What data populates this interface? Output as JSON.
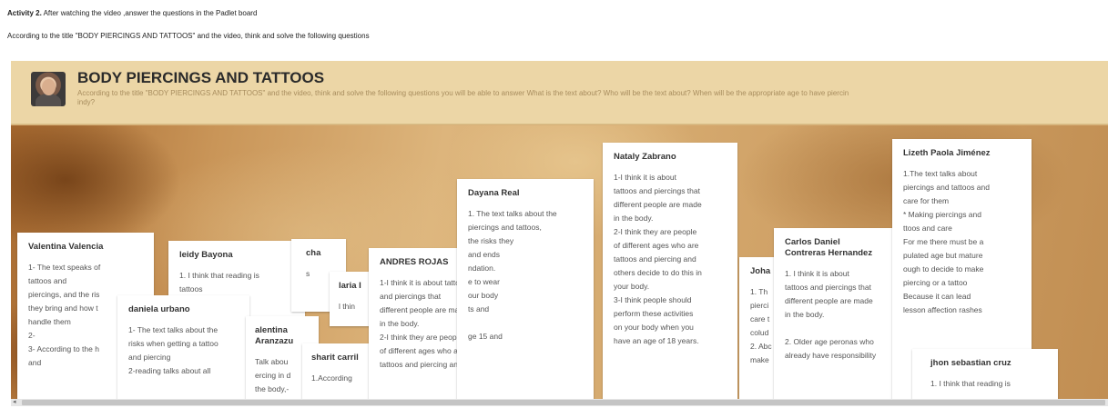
{
  "instructions": {
    "activity_label": "Activity 2.",
    "activity_text": " After watching the video ,answer the questions in the Padlet board",
    "subtitle": "According to the title  \"BODY PIERCINGS AND TATTOOS\" and the video, think and solve the following questions"
  },
  "board": {
    "title": "BODY PIERCINGS AND TATTOOS",
    "description": "According to the title \"BODY PIERCINGS AND TATTOOS\" and the video, think and solve the following questions  you will be able to answer What is the text about? Who will be the text about? When will be the appropriate age to have piercin",
    "description_line2": "indy?"
  },
  "posts": [
    {
      "author": "Valentina Valencia",
      "body": "1- The text speaks of\ntattoos and\npiercings, and the ris\nthey bring and how t\nhandle them\n2-\n3- According to the h\nand"
    },
    {
      "author": "leidy Bayona",
      "body": "1.  I think that reading is\n                    tattoos"
    },
    {
      "author": "cha",
      "body": "s"
    },
    {
      "author": "daniela urbano",
      "body": "1- The text talks about the\nrisks when getting a tattoo\nand piercing\n2-reading talks about all"
    },
    {
      "author": "alentina Aranzazu",
      "body": "Talk abou\nercing in d\nthe body,-"
    },
    {
      "author": "laria I",
      "body": "l thin"
    },
    {
      "author": "sharit carril",
      "body": "1.According"
    },
    {
      "author": "ANDRES ROJAS",
      "body": "1-I think it is about tattoos\nand piercings that\ndifferent people are made\nin the body.\n2-I think they are people\nof different ages who are\ntattoos and piercing and"
    },
    {
      "author": "Dayana Real",
      "body": "1. The text talks about the\npiercings and tattoos,\n          the risks they\n          and ends\n          ndation.\n          e to wear\n          our body\n          ts and\n\n          ge 15 and"
    },
    {
      "author": "Nataly Zabrano",
      "body": "1-I think it is about\ntattoos and piercings that\ndifferent people are made\nin the body.\n2-I think they are people\nof different ages who are\ntattoos and piercing and\nothers decide to do this in\nyour body.\n3-I think people should\nperform these activities\non your body when you\nhave an age of 18 years."
    },
    {
      "author": "Joha",
      "body": "1. Th\npierci\ncare t\ncolud\n2. Abc\nmake"
    },
    {
      "author": "Carlos Daniel\nContreras Hernandez",
      "body": "1. I think it is about\ntattoos and piercings that\ndifferent people are made\nin the body.\n\n2. Older age peronas who\nalready have responsibility"
    },
    {
      "author": "Lizeth Paola Jiménez",
      "body": "1.The text talks about\npiercings and tattoos and\ncare for them\n* Making piercings and\nttoos and care\nFor me there must be a\npulated age but mature\nough to decide to make\npiercing or a tattoo\nBecause it can lead\nlesson  affection  rashes"
    },
    {
      "author": "jhon sebastian cruz",
      "body": "1. I think that reading is"
    }
  ],
  "scrollbar": {
    "arrow": "◂"
  }
}
